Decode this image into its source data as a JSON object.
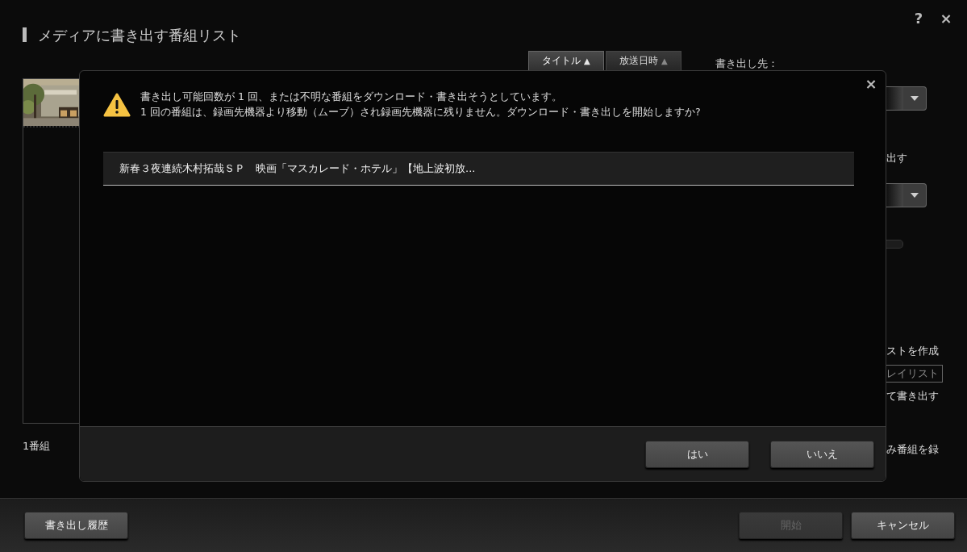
{
  "app": {
    "title": "メディアに書き出す番組リスト",
    "help": "?",
    "close": "×"
  },
  "sort_tabs": [
    {
      "label": "タイトル",
      "arrow": "▲",
      "selected": true
    },
    {
      "label": "放送日時",
      "arrow": "▲",
      "selected": false
    }
  ],
  "destination_label": "書き出し先：",
  "program_count": "1番組",
  "right_panel": [
    {
      "kind": "dropdown"
    },
    {
      "kind": "text",
      "text": "出す"
    },
    {
      "kind": "dropdown"
    },
    {
      "kind": "slider"
    },
    {
      "kind": "text",
      "text": "ストを作成"
    },
    {
      "kind": "field",
      "text": "レイリスト"
    },
    {
      "kind": "text",
      "text": "て書き出す"
    },
    {
      "kind": "text",
      "text": "み番組を録"
    }
  ],
  "footer": {
    "history_button": "書き出し履歴",
    "start_button": {
      "label": "開始",
      "disabled": true
    },
    "cancel_button": "キャンセル"
  },
  "dialog": {
    "close": "×",
    "message_lines": [
      "書き出し可能回数が 1 回、または不明な番組をダウンロード・書き出そうとしています。",
      "1 回の番組は、録画先機器より移動（ムーブ）され録画先機器に残りません。ダウンロード・書き出しを開始しますか?"
    ],
    "programs": [
      {
        "title": "新春３夜連続木村拓哉ＳＰ　映画「マスカレード・ホテル」【地上波初放..."
      }
    ],
    "buttons": [
      {
        "label": "はい"
      },
      {
        "label": "いいえ"
      }
    ]
  }
}
